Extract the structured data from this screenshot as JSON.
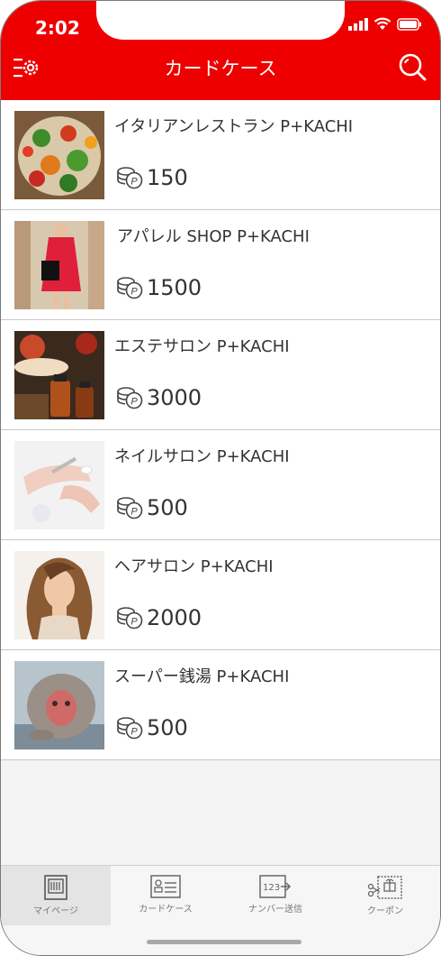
{
  "status_bar": {
    "time": "2:02"
  },
  "header": {
    "title": "カードケース"
  },
  "cards": [
    {
      "name": "イタリアンレストラン P+KACHI",
      "points": "150",
      "thumb": "salad-image"
    },
    {
      "name": "アパレル SHOP P+KACHI",
      "points": "1500",
      "thumb": "fashion-image"
    },
    {
      "name": "エステサロン P+KACHI",
      "points": "3000",
      "thumb": "aroma-oil-image"
    },
    {
      "name": "ネイルサロン P+KACHI",
      "points": "500",
      "thumb": "nail-image"
    },
    {
      "name": "ヘアサロン P+KACHI",
      "points": "2000",
      "thumb": "hair-model-image"
    },
    {
      "name": "スーパー銭湯 P+KACHI",
      "points": "500",
      "thumb": "snow-monkey-image"
    }
  ],
  "tabbar": {
    "items": [
      {
        "label": "マイページ",
        "icon": "mypage-icon",
        "active": true
      },
      {
        "label": "カードケース",
        "icon": "card-case-icon",
        "active": false
      },
      {
        "label": "ナンバー送信",
        "icon": "number-send-icon",
        "active": false
      },
      {
        "label": "クーポン",
        "icon": "coupon-icon",
        "active": false
      }
    ]
  },
  "colors": {
    "accent": "#ee0000",
    "text": "#333333",
    "tab_text": "#777777"
  }
}
